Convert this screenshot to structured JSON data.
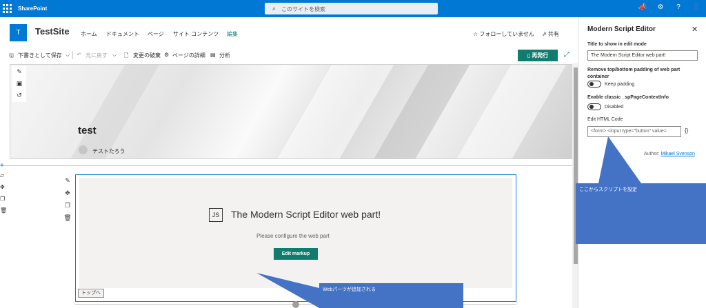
{
  "suitebar": {
    "brand": "SharePoint",
    "search_placeholder": "このサイトを検索",
    "icons": [
      "megaphone-icon",
      "gear-icon",
      "help-icon",
      "person-icon"
    ]
  },
  "site": {
    "logo_letter": "T",
    "title": "TestSite",
    "nav": [
      "ホーム",
      "ドキュメント",
      "ページ",
      "サイト コンテンツ",
      "編集"
    ],
    "follow": "☆ フォローしていません",
    "share": "⇗ 共有"
  },
  "commandbar": {
    "save_draft": "下書きとして保存",
    "undo": "元に戻す",
    "discard": "変更の破棄",
    "page_details": "ページの詳細",
    "analytics": "分析",
    "republish": "再発行"
  },
  "page": {
    "title": "test",
    "author": "テストたろう"
  },
  "webpart": {
    "icon_label": "JS",
    "title": "The Modern Script Editor web part!",
    "subtitle": "Please configure the web part",
    "edit_button": "Edit markup",
    "top_button": "トップへ"
  },
  "pane": {
    "title": "Modern Script Editor",
    "title_label": "Title to show in edit mode",
    "title_value": "The Modern Script Editor web part!",
    "padding_label": "Remove top/bottom padding of web part container",
    "padding_toggle": "Keep padding",
    "context_label": "Enable classic _spPageContextInfo",
    "context_toggle": "Disabled",
    "code_label": "Edit HTML Code",
    "code_value": "<form> <input type=\"button\" value=",
    "code_button": "{}",
    "author_prefix": "Author:",
    "author_name": "Mikael Svenson"
  },
  "callouts": {
    "right": "ここからスクリプトを設定",
    "bottom": "Webパーツが追加される"
  },
  "colors": {
    "suitebar": "#0078d4",
    "accent": "#107c6d",
    "callout": "#4472c4"
  }
}
